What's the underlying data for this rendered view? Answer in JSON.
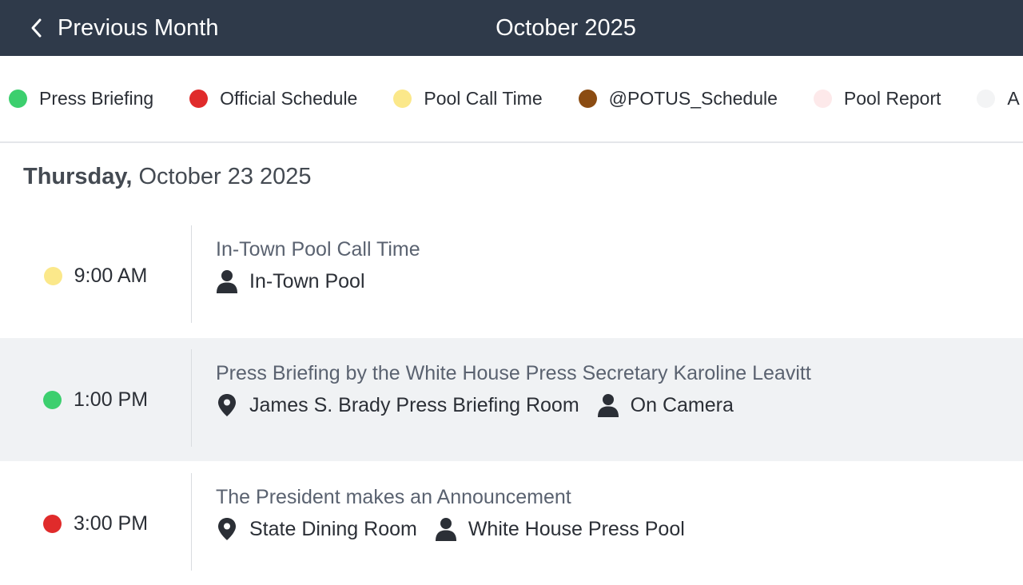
{
  "header": {
    "prev_label": "Previous Month",
    "month_title": "October 2025",
    "bg_color": "#2f3a4a"
  },
  "legend": [
    {
      "label": "Press Briefing",
      "color": "#3ccf6e"
    },
    {
      "label": "Official Schedule",
      "color": "#e02b2b"
    },
    {
      "label": "Pool Call Time",
      "color": "#fbe88a"
    },
    {
      "label": "@POTUS_Schedule",
      "color": "#8b4c12"
    },
    {
      "label": "Pool Report",
      "color": "#fde9ea"
    },
    {
      "label": "A",
      "color": "#f3f4f5"
    }
  ],
  "day": {
    "weekday": "Thursday,",
    "date": "October 23 2025"
  },
  "events": [
    {
      "time": "9:00 AM",
      "dot_color": "#fbe88a",
      "title": "In-Town Pool Call Time",
      "meta": [
        {
          "icon": "person-icon",
          "text": "In-Town Pool"
        }
      ]
    },
    {
      "time": "1:00 PM",
      "dot_color": "#3ccf6e",
      "title": "Press Briefing by the White House Press Secretary Karoline Leavitt",
      "meta": [
        {
          "icon": "location-pin-icon",
          "text": "James S. Brady Press Briefing Room"
        },
        {
          "icon": "person-icon",
          "text": "On Camera"
        }
      ]
    },
    {
      "time": "3:00 PM",
      "dot_color": "#e02b2b",
      "title": "The President makes an Announcement",
      "meta": [
        {
          "icon": "location-pin-icon",
          "text": "State Dining Room"
        },
        {
          "icon": "person-icon",
          "text": "White House Press Pool"
        }
      ]
    }
  ]
}
